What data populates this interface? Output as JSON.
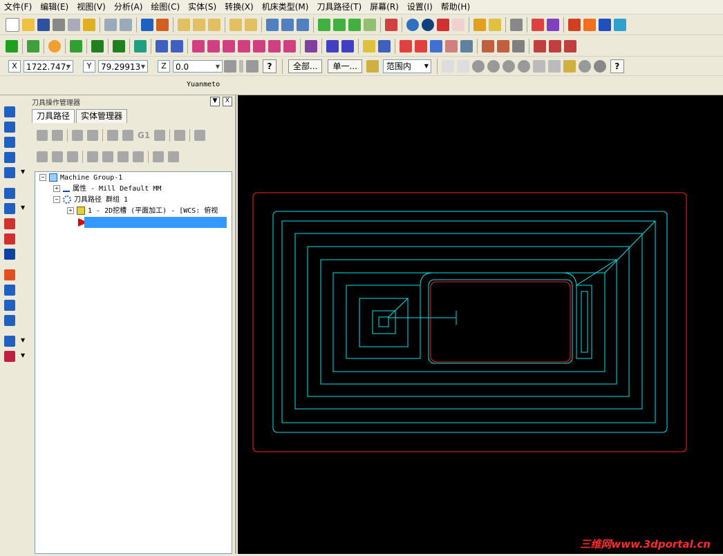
{
  "menu": [
    "文件(F)",
    "编辑(E)",
    "视图(V)",
    "分析(A)",
    "绘图(C)",
    "实体(S)",
    "转换(X)",
    "机床类型(M)",
    "刀具路径(T)",
    "屏幕(R)",
    "设置(I)",
    "帮助(H)"
  ],
  "coords": {
    "x_label": "X",
    "x_value": "1722.747:",
    "y_label": "Y",
    "y_value": "79.29913",
    "z_label": "Z",
    "z_value": "0.0"
  },
  "selection": {
    "all_label": "全部...",
    "single_label": "单一...",
    "range_value": "范围内"
  },
  "username": "Yuanmeto",
  "panel": {
    "title": "刀具操作管理器",
    "close_label": "X",
    "tabs": [
      "刀具路径",
      "实体管理器"
    ]
  },
  "tree": {
    "machine_group": "Machine Group-1",
    "properties": "属性 - Mill Default MM",
    "toolpath_group": "刀具路径 群组 1",
    "operation": "1 - 2D挖槽 (平面加工) - [WCS: 俯视"
  },
  "op_toolbar_text": "G1",
  "watermark": "三维网www.3dportal.cn",
  "colors": {
    "toolpath": "#00e5ee",
    "boundary": "#ff2020",
    "viewport_bg": "#000000"
  }
}
